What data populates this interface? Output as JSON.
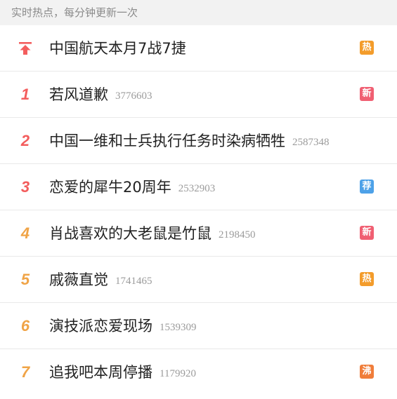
{
  "header": {
    "text": "实时热点，每分钟更新一次"
  },
  "colors": {
    "rank_top3": "#f35d5d",
    "rank_rest": "#f0a447",
    "pin": "#f35d5d",
    "badge_hot": "#f39c2b",
    "badge_new": "#f05f72",
    "badge_recommend": "#4da1e8",
    "badge_boil": "#f07d3a"
  },
  "items": [
    {
      "rank": "",
      "icon": "pin-top-icon",
      "title": "中国航天本月7战7捷",
      "count": "",
      "badge": "热",
      "badge_type": "hot"
    },
    {
      "rank": "1",
      "title": "若风道歉",
      "count": "3776603",
      "badge": "新",
      "badge_type": "new"
    },
    {
      "rank": "2",
      "title": "中国一维和士兵执行任务时染病牺牲",
      "count": "2587348",
      "badge": "",
      "badge_type": ""
    },
    {
      "rank": "3",
      "title": "恋爱的犀牛20周年",
      "count": "2532903",
      "badge": "荐",
      "badge_type": "recommend"
    },
    {
      "rank": "4",
      "title": "肖战喜欢的大老鼠是竹鼠",
      "count": "2198450",
      "badge": "新",
      "badge_type": "new"
    },
    {
      "rank": "5",
      "title": "戚薇直觉",
      "count": "1741465",
      "badge": "热",
      "badge_type": "hot"
    },
    {
      "rank": "6",
      "title": "演技派恋爱现场",
      "count": "1539309",
      "badge": "",
      "badge_type": ""
    },
    {
      "rank": "7",
      "title": "追我吧本周停播",
      "count": "1179920",
      "badge": "沸",
      "badge_type": "boil"
    }
  ]
}
